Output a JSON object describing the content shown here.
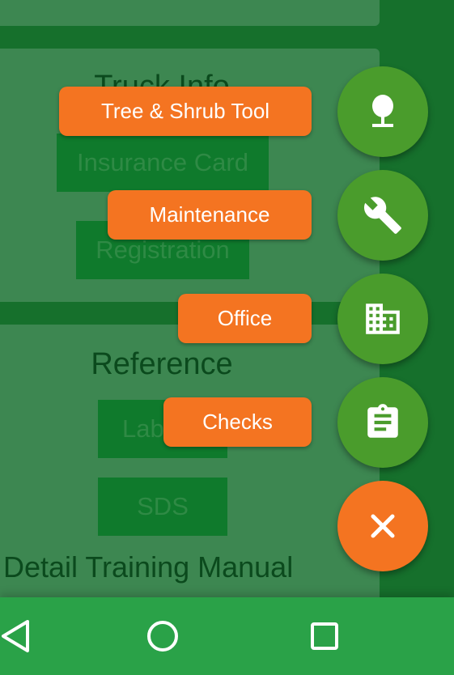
{
  "content": {
    "truck_card": {
      "title": "Truck Info",
      "buttons": [
        "Insurance Card",
        "Registration"
      ]
    },
    "reference_card": {
      "title": "Reference",
      "buttons": [
        "Labels",
        "SDS"
      ],
      "detail_title": "Detail Training Manual"
    }
  },
  "fab_menu": {
    "items": [
      {
        "label": "Tree & Shrub Tool",
        "icon": "tree-icon"
      },
      {
        "label": "Maintenance",
        "icon": "wrench-icon"
      },
      {
        "label": "Office",
        "icon": "building-icon"
      },
      {
        "label": "Checks",
        "icon": "clipboard-icon"
      }
    ],
    "close_icon": "close-icon"
  },
  "navbar": {
    "buttons": [
      "back-icon",
      "home-icon",
      "recents-icon"
    ]
  },
  "colors": {
    "fab_orange": "#f47421",
    "fab_green": "#4a9c2c",
    "navbar": "#2aa248",
    "background": "#16702c"
  }
}
